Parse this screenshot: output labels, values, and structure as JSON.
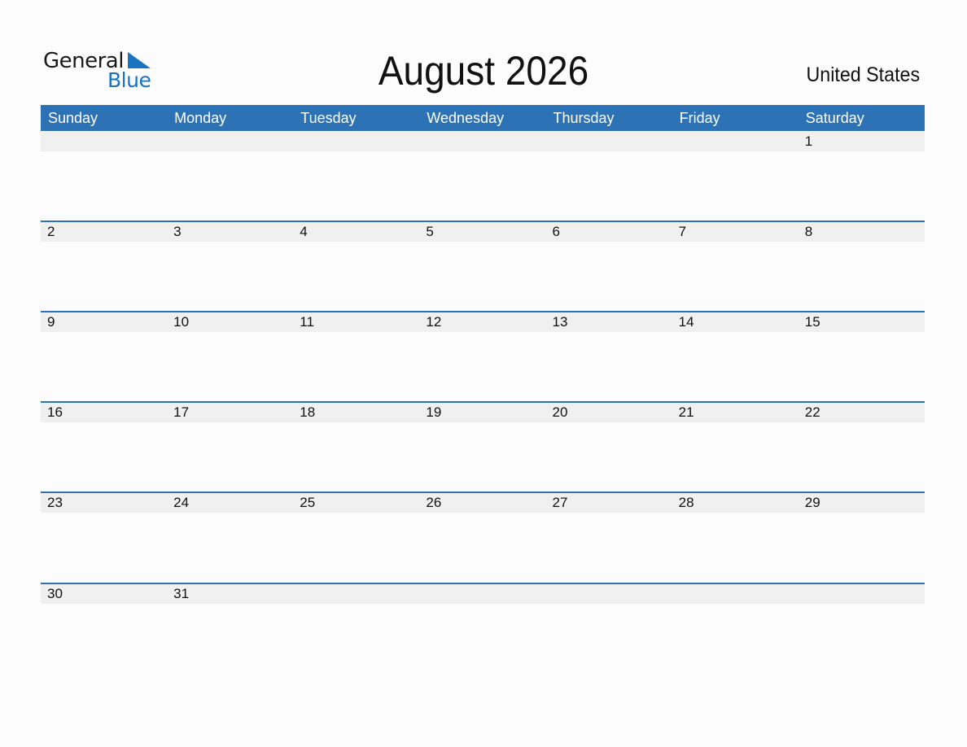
{
  "logo": {
    "line1": "General",
    "line2": "Blue",
    "accent_color": "#1a73c0"
  },
  "title": "August 2026",
  "country": "United States",
  "header_color": "#2c72b4",
  "weekdays": [
    "Sunday",
    "Monday",
    "Tuesday",
    "Wednesday",
    "Thursday",
    "Friday",
    "Saturday"
  ],
  "weeks": [
    [
      "",
      "",
      "",
      "",
      "",
      "",
      "1"
    ],
    [
      "2",
      "3",
      "4",
      "5",
      "6",
      "7",
      "8"
    ],
    [
      "9",
      "10",
      "11",
      "12",
      "13",
      "14",
      "15"
    ],
    [
      "16",
      "17",
      "18",
      "19",
      "20",
      "21",
      "22"
    ],
    [
      "23",
      "24",
      "25",
      "26",
      "27",
      "28",
      "29"
    ],
    [
      "30",
      "31",
      "",
      "",
      "",
      "",
      ""
    ]
  ]
}
